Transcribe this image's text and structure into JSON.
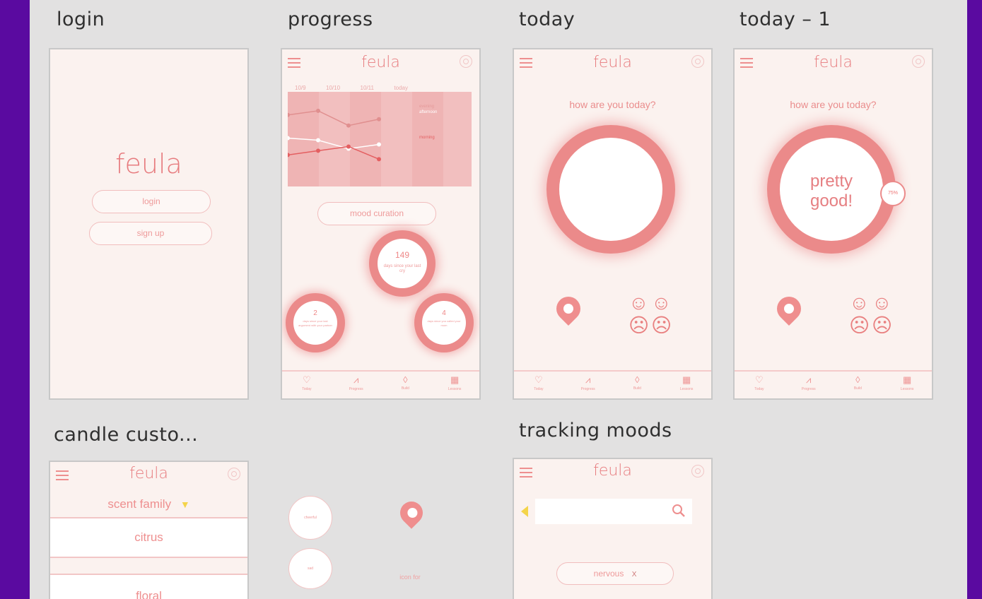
{
  "boards": {
    "login": "login",
    "progress": "progress",
    "today": "today",
    "today1": "today – 1",
    "candle": "candle custo...",
    "tracking": "tracking moods"
  },
  "brand": "feula",
  "login": {
    "login_button": "login",
    "signup_button": "sign up"
  },
  "progress": {
    "dates": [
      "10/9",
      "10/10",
      "10/11",
      "today"
    ],
    "legend": [
      "evening",
      "afternoon",
      "morning"
    ],
    "mood_button": "mood curation",
    "stats": [
      {
        "value": "149",
        "caption": "days since your last cry"
      },
      {
        "value": "2",
        "caption": "days since your last argument with your partner"
      },
      {
        "value": "4",
        "caption": "days since you called your mom"
      }
    ],
    "chart_data": {
      "type": "line",
      "x": [
        "10/9",
        "10/10",
        "10/11",
        "today"
      ],
      "series": [
        {
          "name": "evening",
          "values": [
            3.6,
            3.8,
            3.1,
            3.4
          ]
        },
        {
          "name": "afternoon",
          "values": [
            2.5,
            2.4,
            2.0,
            2.2
          ]
        },
        {
          "name": "morning",
          "values": [
            1.7,
            1.9,
            2.1,
            1.5
          ]
        }
      ],
      "colors": [
        "#e08f8f",
        "#ffffff",
        "#e45f61"
      ]
    }
  },
  "today": {
    "question": "how are you today?",
    "mood_text": "pretty good!",
    "percent": "75%"
  },
  "tabs": [
    {
      "icon": "heart-icon",
      "label": "Today"
    },
    {
      "icon": "trend-icon",
      "label": "Progress"
    },
    {
      "icon": "flame-icon",
      "label": "Build"
    },
    {
      "icon": "book-icon",
      "label": "Lessons"
    }
  ],
  "candle": {
    "dropdown_label": "scent family",
    "items": [
      "citrus",
      "floral"
    ]
  },
  "components": {
    "chip1": "cheerful",
    "chip2": "sad",
    "icon_note": "icon for"
  },
  "tracking": {
    "search_placeholder": "",
    "tag": "nervous",
    "tag_remove": "X"
  },
  "colors": {
    "accent": "#ee8f8f",
    "background": "#fbf2ef",
    "canvas": "#e2e1e1"
  }
}
